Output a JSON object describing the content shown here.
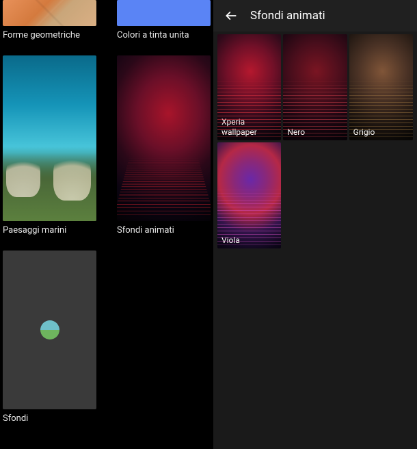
{
  "leftPanel": {
    "categories": [
      {
        "id": "geom",
        "label": "Forme geometriche"
      },
      {
        "id": "solid",
        "label": "Colori a tinta unita"
      },
      {
        "id": "ocean",
        "label": "Paesaggi marini"
      },
      {
        "id": "anim",
        "label": "Sfondi animati"
      },
      {
        "id": "sfondi",
        "label": "Sfondi"
      }
    ]
  },
  "rightPanel": {
    "title": "Sfondi animati",
    "wallpapers": [
      {
        "id": "xperia",
        "label": "Xperia wallpaper"
      },
      {
        "id": "nero",
        "label": "Nero"
      },
      {
        "id": "grigio",
        "label": "Grigio"
      },
      {
        "id": "viola",
        "label": "Viola"
      }
    ]
  }
}
